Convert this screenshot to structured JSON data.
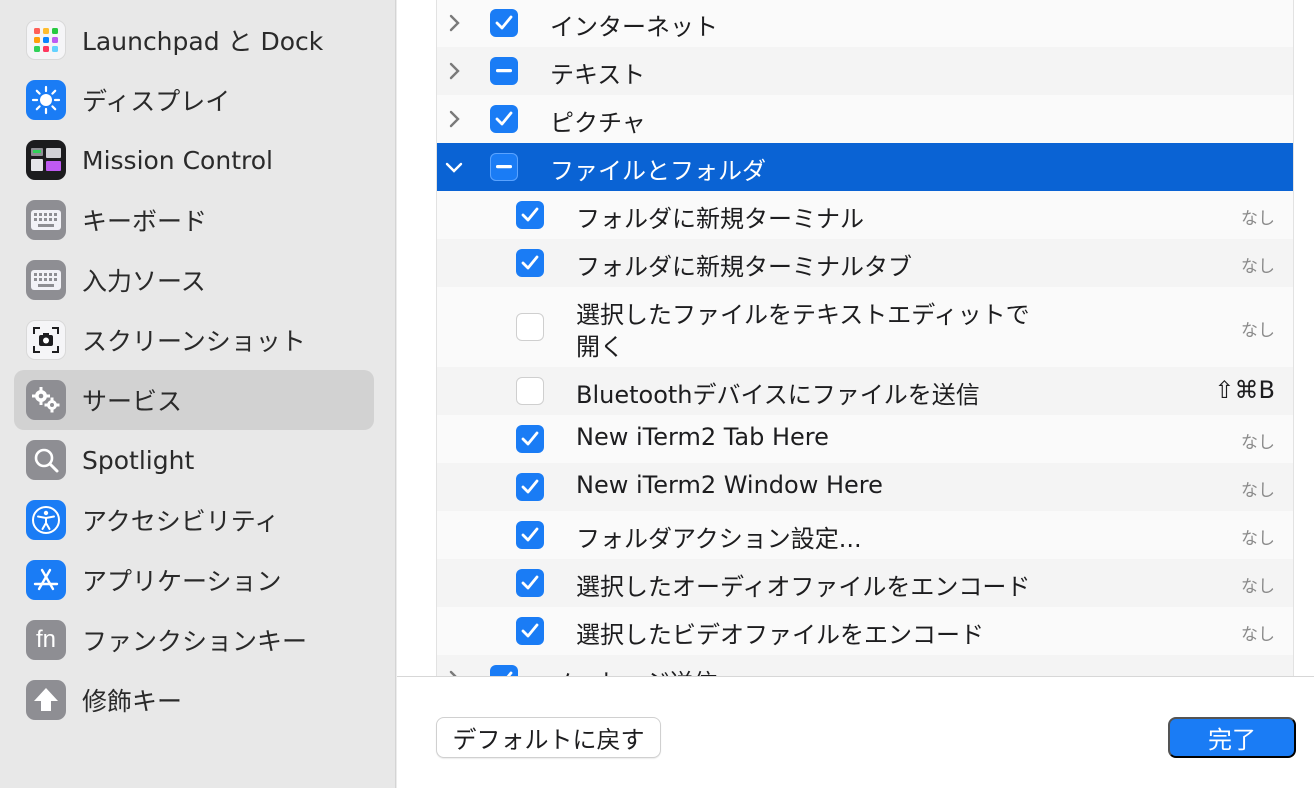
{
  "sidebar": {
    "items": [
      {
        "label": "Launchpad と Dock",
        "icon": "launchpad-icon"
      },
      {
        "label": "ディスプレイ",
        "icon": "display-sun-icon"
      },
      {
        "label": "Mission Control",
        "icon": "mission-control-icon"
      },
      {
        "label": "キーボード",
        "icon": "keyboard-icon"
      },
      {
        "label": "入力ソース",
        "icon": "input-source-keyboard-icon"
      },
      {
        "label": "スクリーンショット",
        "icon": "screenshot-icon"
      },
      {
        "label": "サービス",
        "icon": "gears-icon",
        "selected": true
      },
      {
        "label": "Spotlight",
        "icon": "magnifier-icon"
      },
      {
        "label": "アクセシビリティ",
        "icon": "accessibility-icon"
      },
      {
        "label": "アプリケーション",
        "icon": "app-store-icon"
      },
      {
        "label": "ファンクションキー",
        "icon": "fn-icon"
      },
      {
        "label": "修飾キー",
        "icon": "modifier-arrow-icon"
      }
    ]
  },
  "services": {
    "groups": [
      {
        "label": "インターネット",
        "state": "checked",
        "expanded": false
      },
      {
        "label": "テキスト",
        "state": "mixed",
        "expanded": false
      },
      {
        "label": "ピクチャ",
        "state": "checked",
        "expanded": false
      },
      {
        "label": "ファイルとフォルダ",
        "state": "mixed",
        "expanded": true,
        "selected": true
      }
    ],
    "items": [
      {
        "label": "フォルダに新規ターミナル",
        "checked": true,
        "shortcut": "なし"
      },
      {
        "label": "フォルダに新規ターミナルタブ",
        "checked": true,
        "shortcut": "なし"
      },
      {
        "label": "選択したファイルをテキストエディットで",
        "label2": "開く",
        "checked": false,
        "shortcut": "なし"
      },
      {
        "label": "Bluetoothデバイスにファイルを送信",
        "checked": false,
        "shortcut": "⇧⌘B"
      },
      {
        "label": "New iTerm2 Tab Here",
        "checked": true,
        "shortcut": "なし"
      },
      {
        "label": "New iTerm2 Window Here",
        "checked": true,
        "shortcut": "なし"
      },
      {
        "label": "フォルダアクション設定...",
        "checked": true,
        "shortcut": "なし"
      },
      {
        "label": "選択したオーディオファイルをエンコード",
        "checked": true,
        "shortcut": "なし"
      },
      {
        "label": "選択したビデオファイルをエンコード",
        "checked": true,
        "shortcut": "なし"
      }
    ],
    "next_group": {
      "label": "メッセージ送信",
      "state": "checked"
    }
  },
  "buttons": {
    "restore_defaults": "デフォルトに戻す",
    "done": "完了"
  },
  "colors": {
    "accent": "#1a7cf5",
    "selection": "#0a63d4"
  }
}
